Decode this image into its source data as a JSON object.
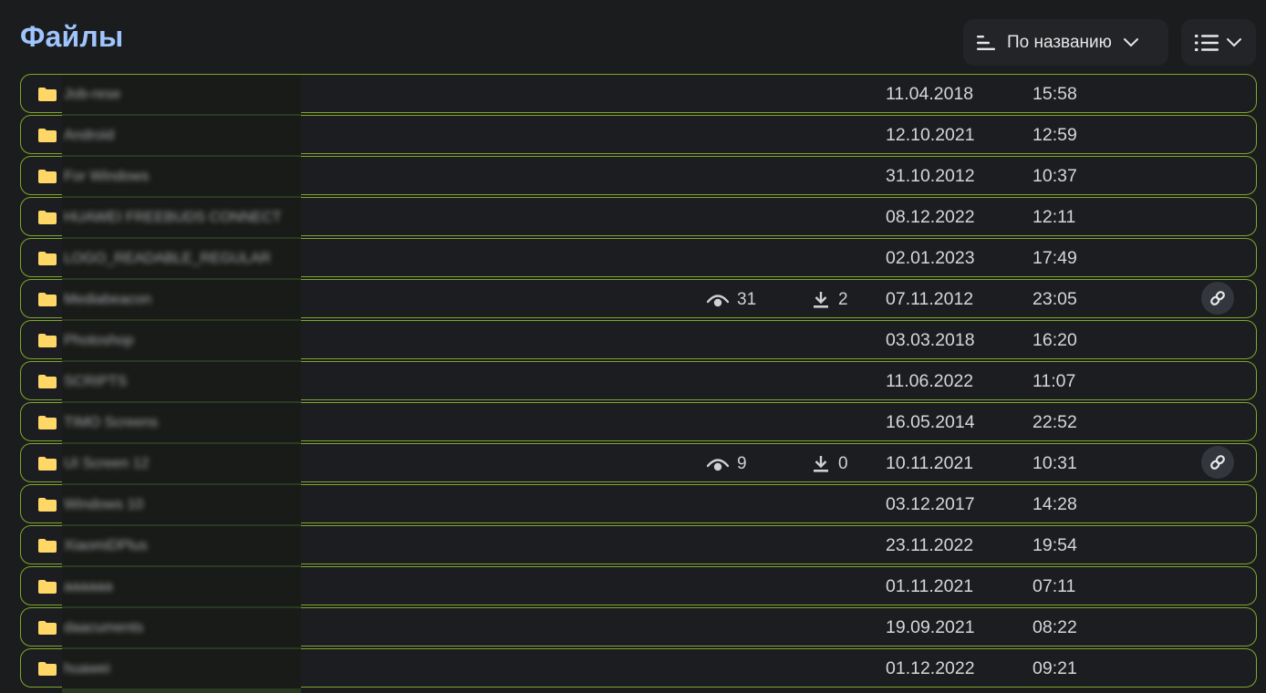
{
  "header": {
    "title": "Файлы",
    "sort_label": "По названию",
    "sort_icon": "sort-lines-icon",
    "view_icon": "list-view-icon"
  },
  "colors": {
    "title": "#9fc5ff",
    "row_border": "#7fa72c",
    "folder": "#ffd766",
    "background": "#1b1c1e"
  },
  "files": [
    {
      "name": "Job-rese",
      "date": "11.04.2018",
      "time": "15:58"
    },
    {
      "name": "Android",
      "date": "12.10.2021",
      "time": "12:59"
    },
    {
      "name": "For Windows",
      "date": "31.10.2012",
      "time": "10:37"
    },
    {
      "name": "HUAWEI FREEBUDS CONNECT",
      "date": "08.12.2022",
      "time": "12:11"
    },
    {
      "name": "LOGO_READABLE_REGULAR",
      "date": "02.01.2023",
      "time": "17:49"
    },
    {
      "name": "Mediabeacon",
      "views": "31",
      "downloads": "2",
      "date": "07.11.2012",
      "time": "23:05",
      "shared": true
    },
    {
      "name": "Photoshop",
      "date": "03.03.2018",
      "time": "16:20"
    },
    {
      "name": "SCRIPTS",
      "date": "11.06.2022",
      "time": "11:07"
    },
    {
      "name": "TIMO Screens",
      "date": "16.05.2014",
      "time": "22:52"
    },
    {
      "name": "UI Screen 12",
      "views": "9",
      "downloads": "0",
      "date": "10.11.2021",
      "time": "10:31",
      "shared": true
    },
    {
      "name": "Windows 10",
      "date": "03.12.2017",
      "time": "14:28"
    },
    {
      "name": "XiaomiDPlus",
      "date": "23.11.2022",
      "time": "19:54"
    },
    {
      "name": "aaaaaa",
      "date": "01.11.2021",
      "time": "07:11"
    },
    {
      "name": "daacuments",
      "date": "19.09.2021",
      "time": "08:22"
    },
    {
      "name": "huawei",
      "date": "01.12.2022",
      "time": "09:21"
    }
  ]
}
